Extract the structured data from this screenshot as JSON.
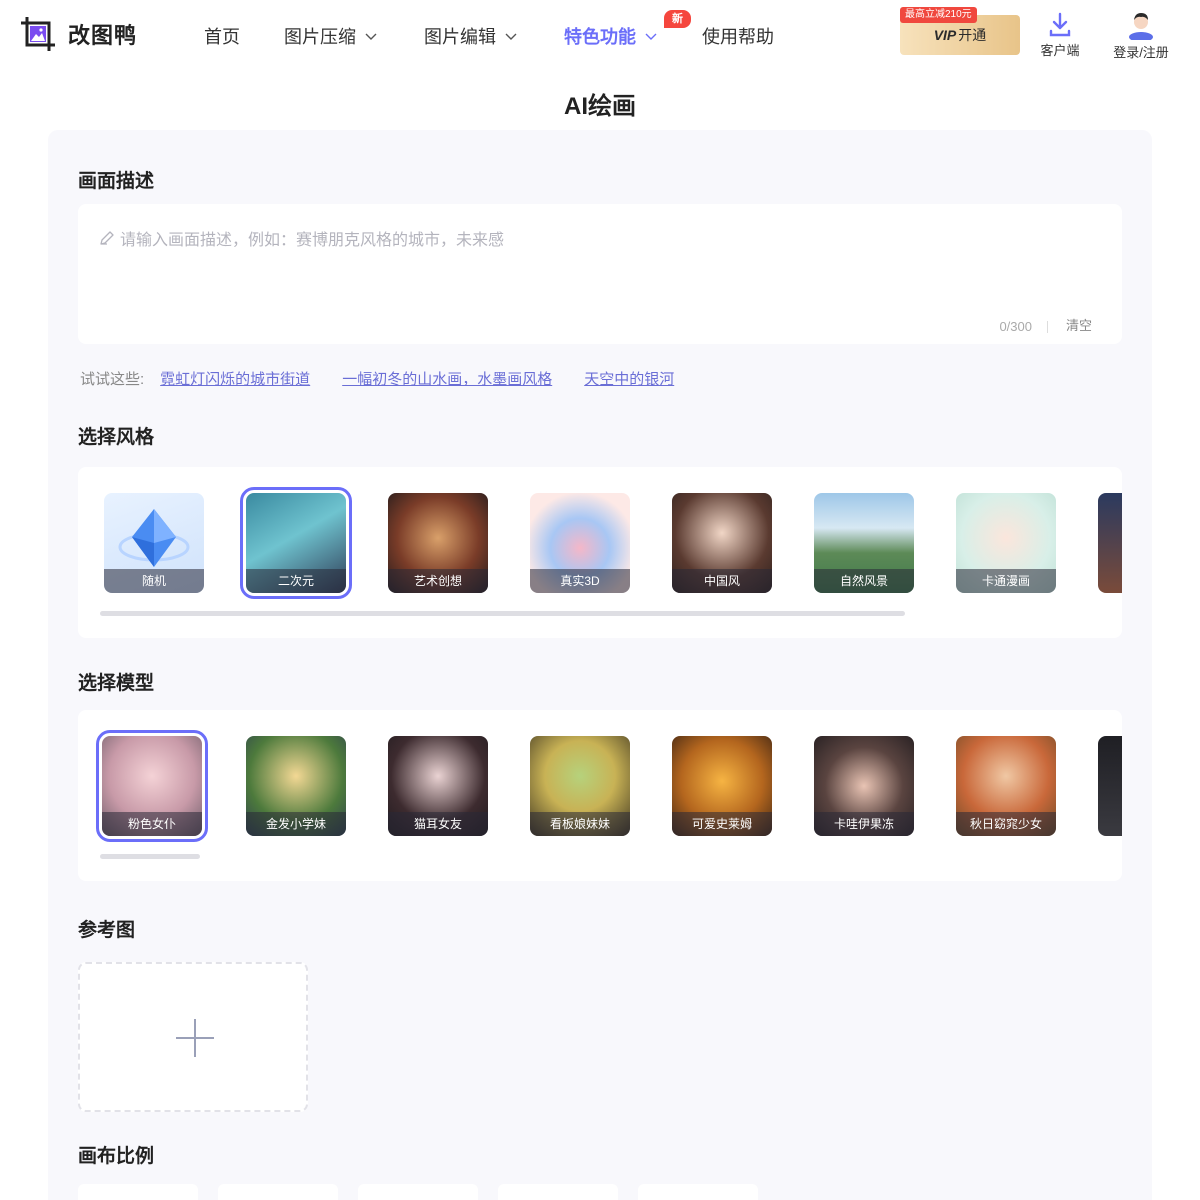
{
  "header": {
    "brand": "改图鸭",
    "nav": [
      {
        "label": "首页",
        "dropdown": false,
        "active": false
      },
      {
        "label": "图片压缩",
        "dropdown": true,
        "active": false
      },
      {
        "label": "图片编辑",
        "dropdown": true,
        "active": false
      },
      {
        "label": "特色功能",
        "dropdown": true,
        "active": true,
        "badge": "新"
      },
      {
        "label": "使用帮助",
        "dropdown": false,
        "active": false
      }
    ],
    "vip_tag": "最高立减210元",
    "vip_label": "VIP",
    "vip_action": "开通",
    "client_label": "客户端",
    "login_label": "登录/注册"
  },
  "page": {
    "title": "AI绘画"
  },
  "description": {
    "title": "画面描述",
    "placeholder": "请输入画面描述，例如：赛博朋克风格的城市，未来感",
    "counter": "0/300",
    "clear_label": "清空",
    "try_label": "试试这些:",
    "suggestions": [
      "霓虹灯闪烁的城市街道",
      "一幅初冬的山水画，水墨画风格",
      "天空中的银河"
    ]
  },
  "style": {
    "title": "选择风格",
    "selected": "二次元",
    "items": [
      "随机",
      "二次元",
      "艺术创想",
      "真实3D",
      "中国风",
      "自然风景",
      "卡通漫画"
    ]
  },
  "model": {
    "title": "选择模型",
    "selected": "粉色女仆",
    "items": [
      "粉色女仆",
      "金发小学妹",
      "猫耳女友",
      "看板娘妹妹",
      "可爱史莱姆",
      "卡哇伊果冻",
      "秋日窈窕少女"
    ]
  },
  "reference": {
    "title": "参考图"
  },
  "canvas": {
    "title": "画布比例"
  },
  "colors": {
    "accent": "#6b6ef9",
    "link": "#6a6ed6",
    "badge": "#f5463d"
  }
}
